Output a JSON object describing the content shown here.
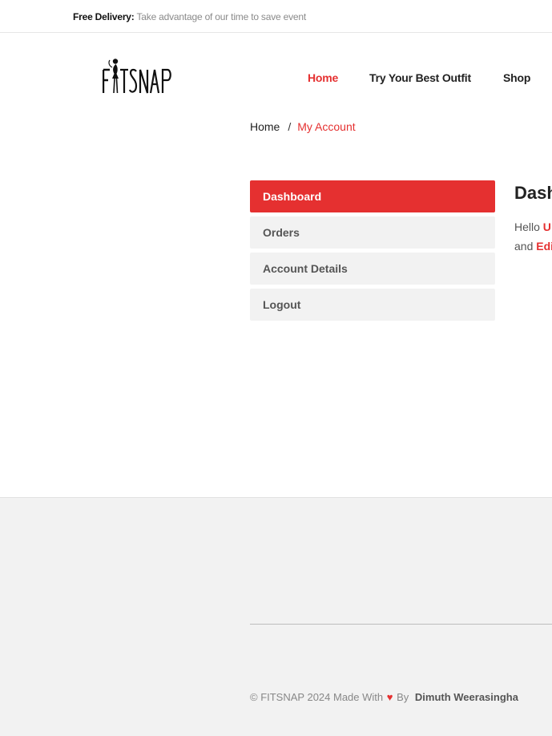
{
  "topbar": {
    "promo_label": "Free Delivery:",
    "promo_text": "Take advantage of our time to save event"
  },
  "brand": {
    "logo_text": "FITSNAP"
  },
  "nav": {
    "items": [
      "Home",
      "Try Your Best Outfit",
      "Shop"
    ],
    "active": "Home"
  },
  "breadcrumb": {
    "home": "Home",
    "separator": "/",
    "current": "My Account"
  },
  "account_menu": {
    "items": [
      "Dashboard",
      "Orders",
      "Account Details",
      "Logout"
    ],
    "active": "Dashboard"
  },
  "dashboard": {
    "title": "Dash",
    "line1_prefix": "Hello ",
    "line1_highlight": "U",
    "line2_prefix": "and ",
    "line2_highlight": "Edi"
  },
  "footer": {
    "copyright_prefix": "© FITSNAP 2024 Made With",
    "heart": "♥",
    "by": "By",
    "author": "Dimuth Weerasingha"
  },
  "colors": {
    "accent": "#e53030",
    "muted_bg": "#f2f2f2"
  }
}
